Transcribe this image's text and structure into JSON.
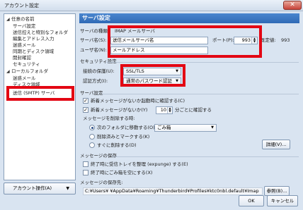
{
  "window": {
    "title": "アカウント設定",
    "close_glyph": "✕"
  },
  "sidebar": {
    "items": [
      {
        "label": "任意の名前",
        "expanded": true
      },
      {
        "label": "サーバ設定"
      },
      {
        "label": "送信控えと特別なフォルダ"
      },
      {
        "label": "編集とアドレス入力"
      },
      {
        "label": "迷惑メール"
      },
      {
        "label": "同期とディスク領域"
      },
      {
        "label": "開封確認"
      },
      {
        "label": "セキュリティ"
      },
      {
        "label": "ローカルフォルダ",
        "expanded": true
      },
      {
        "label": "迷惑メール"
      },
      {
        "label": "ディスク領域"
      },
      {
        "label": "送信 (SMTP) サーバ",
        "selected": true
      }
    ],
    "expand_glyph": "◢"
  },
  "account_actions": {
    "label": "アカウント操作(A)",
    "arrow": "▼"
  },
  "panel": {
    "title": "サーバ設定",
    "server_type_label": "サーバの種類:",
    "server_type_value": "IMAP メールサーバ",
    "server_name_label": "サーバ名(S):",
    "server_name_value": "送信メールサーバ名",
    "port_label": "ポート(P):",
    "port_value": "993",
    "default_label": "既定値:",
    "default_value": "993",
    "username_label": "ユーザ名(N):",
    "username_value": "メールアドレス",
    "security_section": "セキュリティ設定",
    "conn_security_label": "接続の保護(U):",
    "conn_security_value": "SSL/TLS",
    "auth_label": "認証方式(I):",
    "auth_value": "通常のパスワード認証",
    "server_settings_section": "サーバ設定",
    "check_on_start_label": "新着メッセージがないか起動時に確認する(C)",
    "check_every_label": "新着メッセージがないか(Y)",
    "check_every_value": "10",
    "check_every_suffix": "分ごとに確認する",
    "delete_label": "メッセージを削除する時:",
    "delete_option1": "次のフォルダに移動する(O):",
    "delete_folder": "ごみ箱",
    "delete_option2": "削除済みとマークする(K)",
    "delete_option3": "すぐに削除する(D)",
    "advanced_button": "詳細(V)...",
    "storage_section": "メッセージの保存",
    "expunge_label": "終了時に受信トレイを整理 (expunge) する(E)",
    "empty_trash_label": "終了時にごみ箱を空にする(X)",
    "storage_location_label": "メッセージの保存先:",
    "storage_path": "C:¥Users¥        ¥AppData¥Roaming¥Thunderbird¥Profiles¥ktc0nbl.default¥Imap",
    "browse_button": "参照(B)...",
    "ok_button": "OK",
    "cancel_button": "キャンセル",
    "check_glyph": "✓",
    "dropdown_glyph": "▼",
    "spin_up": "▲",
    "spin_down": "▼"
  },
  "colors": {
    "highlight": "#e30613",
    "header": "#2f6ab5",
    "background": "#d9e4f1"
  }
}
